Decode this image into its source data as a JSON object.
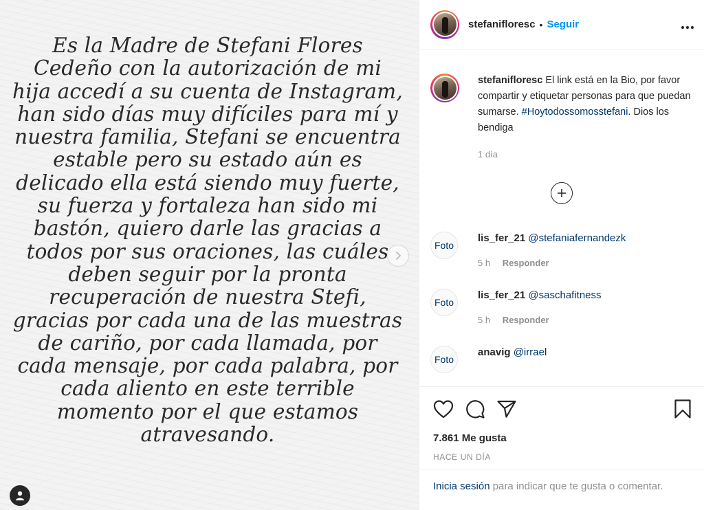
{
  "post": {
    "image_text": "Es la Madre de Stefani Flores Cedeño con la autorización de mi hija accedí a su cuenta de Instagram, han sido días muy difíciles para mí y nuestra familia, Stefani se encuentra estable pero su estado aún es delicado ella está siendo muy fuerte, su fuerza y fortaleza han sido mi bastón, quiero darle las gracias a todos por sus oraciones, las cuáles deben seguir por la pronta recuperación de nuestra Stefi, gracias por cada una de las muestras de cariño, por cada llamada, por cada mensaje, por cada palabra, por cada aliento en este terrible momento por el que estamos atravesando.",
    "next_icon": "chevron-right-icon",
    "user_tag_icon": "user-icon"
  },
  "header": {
    "username": "stefanifloresc",
    "dot": "•",
    "follow_label": "Seguir",
    "more_icon": "more-icon"
  },
  "caption": {
    "username": "stefanifloresc",
    "text": "El link está en la Bio, por favor compartir y etiquetar personas para que puedan sumarse.",
    "hashtag": "#Hoytodossomosstefani",
    "text_after": ". Dios los bendiga",
    "time": "1 día"
  },
  "load_more_icon": "plus-circle-icon",
  "comments": [
    {
      "avatar_alt": "Foto",
      "username": "lis_fer_21",
      "mention": "@stefaniafernandezk",
      "time": "5 h",
      "reply_label": "Responder"
    },
    {
      "avatar_alt": "Foto",
      "username": "lis_fer_21",
      "mention": "@saschafitness",
      "time": "5 h",
      "reply_label": "Responder"
    },
    {
      "avatar_alt": "Foto",
      "username": "anavig",
      "mention": "@irrael",
      "time": "",
      "reply_label": ""
    }
  ],
  "actions": {
    "like_icon": "heart-icon",
    "comment_icon": "comment-icon",
    "share_icon": "paper-plane-icon",
    "save_icon": "bookmark-icon",
    "likes": "7.861 Me gusta",
    "time": "Hace un día"
  },
  "login": {
    "link": "Inicia sesión",
    "text": " para indicar que te gusta o comentar."
  },
  "colors": {
    "link_blue": "#0095f6",
    "dark_link": "#00376b",
    "muted": "#8e8e8e"
  }
}
